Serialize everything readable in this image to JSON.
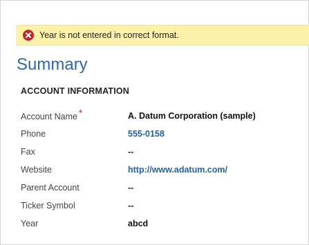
{
  "notification": {
    "message": "Year is not entered in correct format.",
    "icon": "error-icon",
    "background": "#fcf1a9",
    "icon_color": "#c4262e"
  },
  "summary": {
    "title": "Summary"
  },
  "section": {
    "heading": "ACCOUNT INFORMATION"
  },
  "fields": [
    {
      "label": "Account Name",
      "required_marker": "*",
      "value": "A. Datum Corporation (sample)"
    },
    {
      "label": "Phone",
      "value": "555-0158"
    },
    {
      "label": "Fax",
      "value": "--"
    },
    {
      "label": "Website",
      "value": "http://www.adatum.com/"
    },
    {
      "label": "Parent Account",
      "value": "--"
    },
    {
      "label": "Ticker Symbol",
      "value": "--"
    },
    {
      "label": "Year",
      "value": "abcd"
    }
  ],
  "colors": {
    "title": "#2e68b4",
    "link": "#2164ae",
    "required": "#c0141a"
  }
}
